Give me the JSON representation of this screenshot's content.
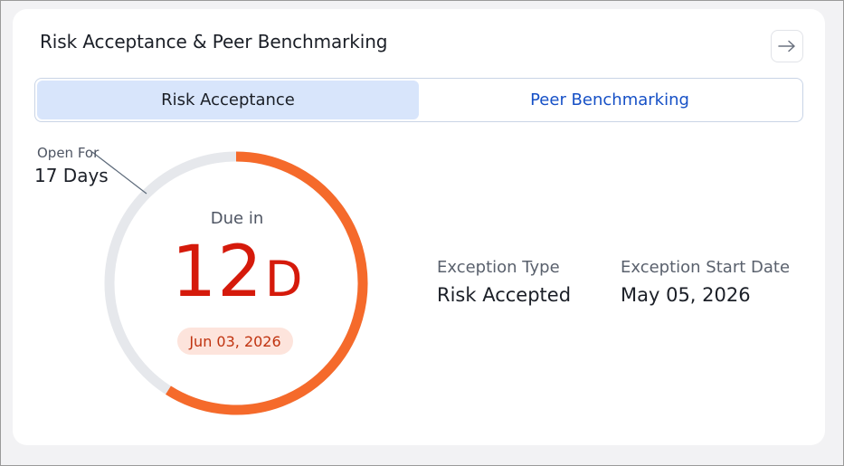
{
  "card": {
    "title": "Risk Acceptance & Peer Benchmarking",
    "nav_icon": "arrow-right-icon"
  },
  "tabs": [
    {
      "label": "Risk Acceptance",
      "active": true
    },
    {
      "label": "Peer Benchmarking",
      "active": false
    }
  ],
  "progress": {
    "open_for_label": "Open For",
    "open_for_value": "17 Days",
    "due_label": "Due in",
    "due_number": "12",
    "due_unit": "D",
    "due_date": "Jun 03, 2026",
    "elapsed_fraction": 0.41,
    "colors": {
      "remaining": "#f56a2b",
      "elapsed": "#e6e8ec"
    }
  },
  "details": [
    {
      "label": "Exception Type",
      "value": "Risk Accepted"
    },
    {
      "label": "Exception Start Date",
      "value": "May 05, 2026"
    }
  ]
}
